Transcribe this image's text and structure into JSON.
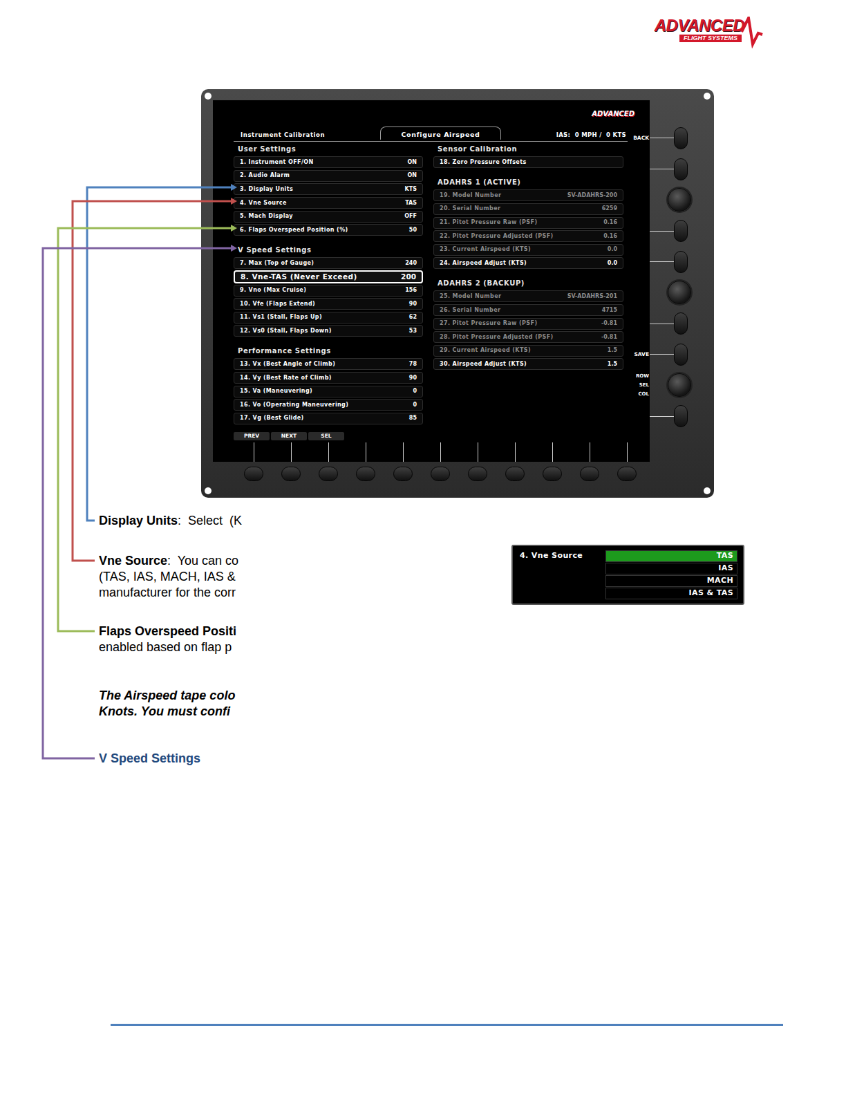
{
  "logo": {
    "brand": "ADVANCED",
    "tagline": "FLIGHT SYSTEMS"
  },
  "device": {
    "screenLogo": "ADVANCED",
    "header": {
      "left": "Instrument Calibration",
      "tab": "Configure Airspeed",
      "reading": "IAS:  0 MPH /  0 KTS"
    },
    "columns": [
      [
        {
          "title": "User Settings",
          "rows": [
            {
              "label": "1. Instrument OFF/ON",
              "value": "ON",
              "selected": false,
              "disabled": false
            },
            {
              "label": "2. Audio Alarm",
              "value": "ON",
              "selected": false,
              "disabled": false
            },
            {
              "label": "3. Display Units",
              "value": "KTS",
              "selected": false,
              "disabled": false
            },
            {
              "label": "4. Vne Source",
              "value": "TAS",
              "selected": false,
              "disabled": false
            },
            {
              "label": "5. Mach Display",
              "value": "OFF",
              "selected": false,
              "disabled": false
            },
            {
              "label": "6. Flaps Overspeed Position (%)",
              "value": "50",
              "selected": false,
              "disabled": false
            }
          ]
        },
        {
          "title": "V Speed Settings",
          "rows": [
            {
              "label": "7. Max (Top of Gauge)",
              "value": "240",
              "selected": false,
              "disabled": false
            },
            {
              "label": "8. Vne-TAS (Never Exceed)",
              "value": "200",
              "selected": true,
              "disabled": false
            },
            {
              "label": "9. Vno (Max Cruise)",
              "value": "156",
              "selected": false,
              "disabled": false
            },
            {
              "label": "10. Vfe (Flaps Extend)",
              "value": "90",
              "selected": false,
              "disabled": false
            },
            {
              "label": "11. Vs1 (Stall, Flaps Up)",
              "value": "62",
              "selected": false,
              "disabled": false
            },
            {
              "label": "12. Vs0 (Stall, Flaps Down)",
              "value": "53",
              "selected": false,
              "disabled": false
            }
          ]
        },
        {
          "title": "Performance Settings",
          "rows": [
            {
              "label": "13. Vx (Best Angle of Climb)",
              "value": "78",
              "selected": false,
              "disabled": false
            },
            {
              "label": "14. Vy (Best Rate of Climb)",
              "value": "90",
              "selected": false,
              "disabled": false
            },
            {
              "label": "15. Va (Maneuvering)",
              "value": "0",
              "selected": false,
              "disabled": false
            },
            {
              "label": "16. Vo (Operating Maneuvering)",
              "value": "0",
              "selected": false,
              "disabled": false
            },
            {
              "label": "17. Vg (Best Glide)",
              "value": "85",
              "selected": false,
              "disabled": false
            }
          ]
        }
      ],
      [
        {
          "title": "Sensor Calibration",
          "rows": [
            {
              "label": "18. Zero Pressure Offsets",
              "selected": false,
              "disabled": false
            }
          ]
        },
        {
          "title": "ADAHRS 1 (ACTIVE)",
          "rows": [
            {
              "label": "19. Model Number",
              "value": "SV-ADAHRS-200",
              "selected": false,
              "disabled": true
            },
            {
              "label": "20. Serial Number",
              "value": "6259",
              "selected": false,
              "disabled": true
            },
            {
              "label": "21. Pitot Pressure Raw (PSF)",
              "value": "0.16",
              "selected": false,
              "disabled": true
            },
            {
              "label": "22. Pitot Pressure Adjusted (PSF)",
              "value": "0.16",
              "selected": false,
              "disabled": true
            },
            {
              "label": "23. Current Airspeed (KTS)",
              "value": "0.0",
              "selected": false,
              "disabled": true
            },
            {
              "label": "24. Airspeed Adjust (KTS)",
              "value": "0.0",
              "selected": false,
              "disabled": false
            }
          ]
        },
        {
          "title": "ADAHRS 2 (BACKUP)",
          "rows": [
            {
              "label": "25. Model Number",
              "value": "SV-ADAHRS-201",
              "selected": false,
              "disabled": true
            },
            {
              "label": "26. Serial Number",
              "value": "4715",
              "selected": false,
              "disabled": true
            },
            {
              "label": "27. Pitot Pressure Raw (PSF)",
              "value": "-0.81",
              "selected": false,
              "disabled": true
            },
            {
              "label": "28. Pitot Pressure Adjusted (PSF)",
              "value": "-0.81",
              "selected": false,
              "disabled": true
            },
            {
              "label": "29. Current Airspeed (KTS)",
              "value": "1.5",
              "selected": false,
              "disabled": true
            },
            {
              "label": "30. Airspeed Adjust (KTS)",
              "value": "1.5",
              "selected": false,
              "disabled": false
            }
          ]
        }
      ]
    ],
    "softkeys": [
      "PREV",
      "NEXT",
      "SEL"
    ],
    "sideControls": [
      {
        "kind": "button",
        "labels": [
          "BACK"
        ]
      },
      {
        "kind": "button",
        "labels": []
      },
      {
        "kind": "knob",
        "labels": []
      },
      {
        "kind": "button",
        "labels": []
      },
      {
        "kind": "button",
        "labels": []
      },
      {
        "kind": "knob",
        "labels": []
      },
      {
        "kind": "button",
        "labels": []
      },
      {
        "kind": "button",
        "labels": [
          "SAVE"
        ]
      },
      {
        "kind": "knob",
        "labels": [
          "ROW",
          "SEL",
          "COL"
        ]
      },
      {
        "kind": "button",
        "labels": []
      }
    ]
  },
  "notes": [
    {
      "kind": "definition",
      "title": "Display Units",
      "rest": ":  Select  (K",
      "more": [],
      "color": "#4f81bd"
    },
    {
      "kind": "definition",
      "title": "Vne Source",
      "rest": ":  You can co",
      "more": [
        "(TAS, IAS, MACH, IAS &",
        "manufacturer for the corr"
      ],
      "color": "#c0504d"
    },
    {
      "kind": "definition",
      "title": "Flaps Overspeed Positi",
      "more": [
        "enabled based on flap p"
      ],
      "color": "#9bbb59"
    },
    {
      "kind": "italic",
      "more": [
        "The Airspeed tape colo",
        "Knots. You must confi"
      ]
    },
    {
      "kind": "heading",
      "title": "V Speed Settings",
      "more": [],
      "color": "#8064a2"
    }
  ],
  "inset": {
    "label": "4. Vne Source",
    "options": [
      {
        "label": "TAS",
        "selected": true
      },
      {
        "label": "IAS",
        "selected": false
      },
      {
        "label": "MACH",
        "selected": false
      },
      {
        "label": "IAS & TAS",
        "selected": false
      }
    ]
  }
}
